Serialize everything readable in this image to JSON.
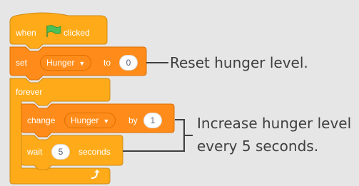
{
  "blocks": {
    "when_flag": {
      "when": "when",
      "clicked": "clicked",
      "flag_icon": "green-flag-icon"
    },
    "set": {
      "set": "set",
      "variable": "Hunger",
      "to": "to",
      "value": "0"
    },
    "forever": {
      "label": "forever",
      "loop_icon": "loop-arrow-icon"
    },
    "change": {
      "change": "change",
      "variable": "Hunger",
      "by": "by",
      "value": "1"
    },
    "wait": {
      "wait": "wait",
      "value": "5",
      "seconds": "seconds"
    }
  },
  "annotations": {
    "reset": "Reset hunger level.",
    "increase_line1": "Increase hunger level",
    "increase_line2": "every 5 seconds."
  },
  "colors": {
    "background": "#e6e6e6",
    "control": "#ffab19",
    "variables": "#ff8c1a",
    "flag": "#4cbf56",
    "annotation_text": "#3f3f3f"
  }
}
